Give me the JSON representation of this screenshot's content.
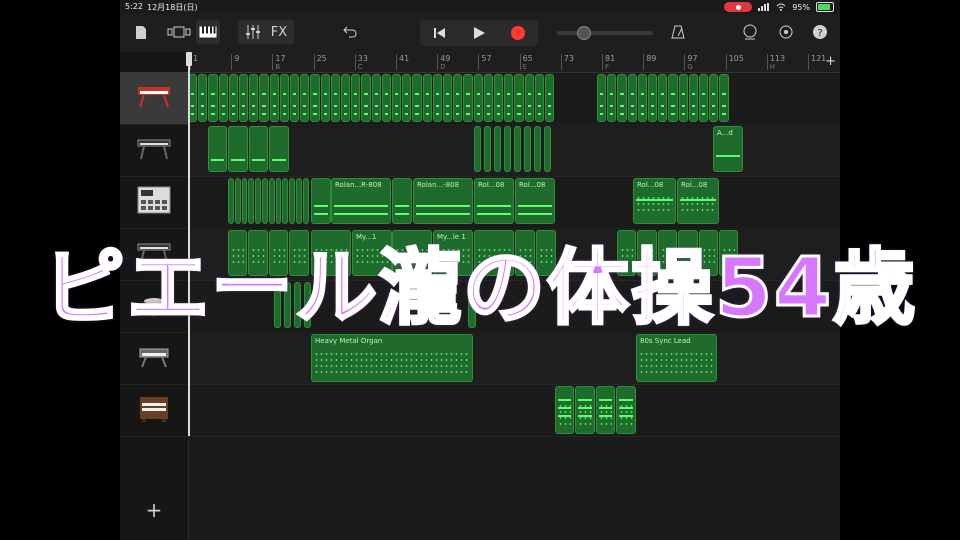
{
  "status_bar": {
    "time": "5:22",
    "date": "12月18日(日)",
    "battery": "95%"
  },
  "toolbar": {
    "fx_label": "FX"
  },
  "ruler": {
    "bars": [
      {
        "n": "1",
        "s": ""
      },
      {
        "n": "9",
        "s": ""
      },
      {
        "n": "17",
        "s": "B"
      },
      {
        "n": "25",
        "s": ""
      },
      {
        "n": "33",
        "s": "C"
      },
      {
        "n": "41",
        "s": ""
      },
      {
        "n": "49",
        "s": "D"
      },
      {
        "n": "57",
        "s": ""
      },
      {
        "n": "65",
        "s": "E"
      },
      {
        "n": "73",
        "s": ""
      },
      {
        "n": "81",
        "s": "F"
      },
      {
        "n": "89",
        "s": ""
      },
      {
        "n": "97",
        "s": "G"
      },
      {
        "n": "105",
        "s": ""
      },
      {
        "n": "113",
        "s": "H"
      },
      {
        "n": "121",
        "s": ""
      }
    ],
    "add_label": "+"
  },
  "tracks": [
    {
      "icon": "red-keyboard-icon"
    },
    {
      "icon": "keyboard-icon"
    },
    {
      "icon": "drum-machine-icon"
    },
    {
      "icon": "keyboard-icon"
    },
    {
      "icon": "drum-kit-icon"
    },
    {
      "icon": "synth-icon"
    },
    {
      "icon": "organ-icon"
    }
  ],
  "region_labels": {
    "r1": "Rolan...R-808",
    "r2": "Rolan...-808",
    "r3": "Rol...08",
    "r4": "Rol...08",
    "r5": "Rol...08",
    "r6": "Rol...08",
    "r7": "My...1",
    "r8": "My...le 1",
    "r9": "A...d",
    "r10": "Heavy Metal Organ",
    "r11": "80s Sync Lead"
  },
  "add_track_label": "+",
  "overlay_title": "ピエール瀧の体操54歳",
  "colors": {
    "region_fill": "#1f6b2c",
    "region_border": "#2e8f3c",
    "overlay_text": "#d776ff"
  }
}
